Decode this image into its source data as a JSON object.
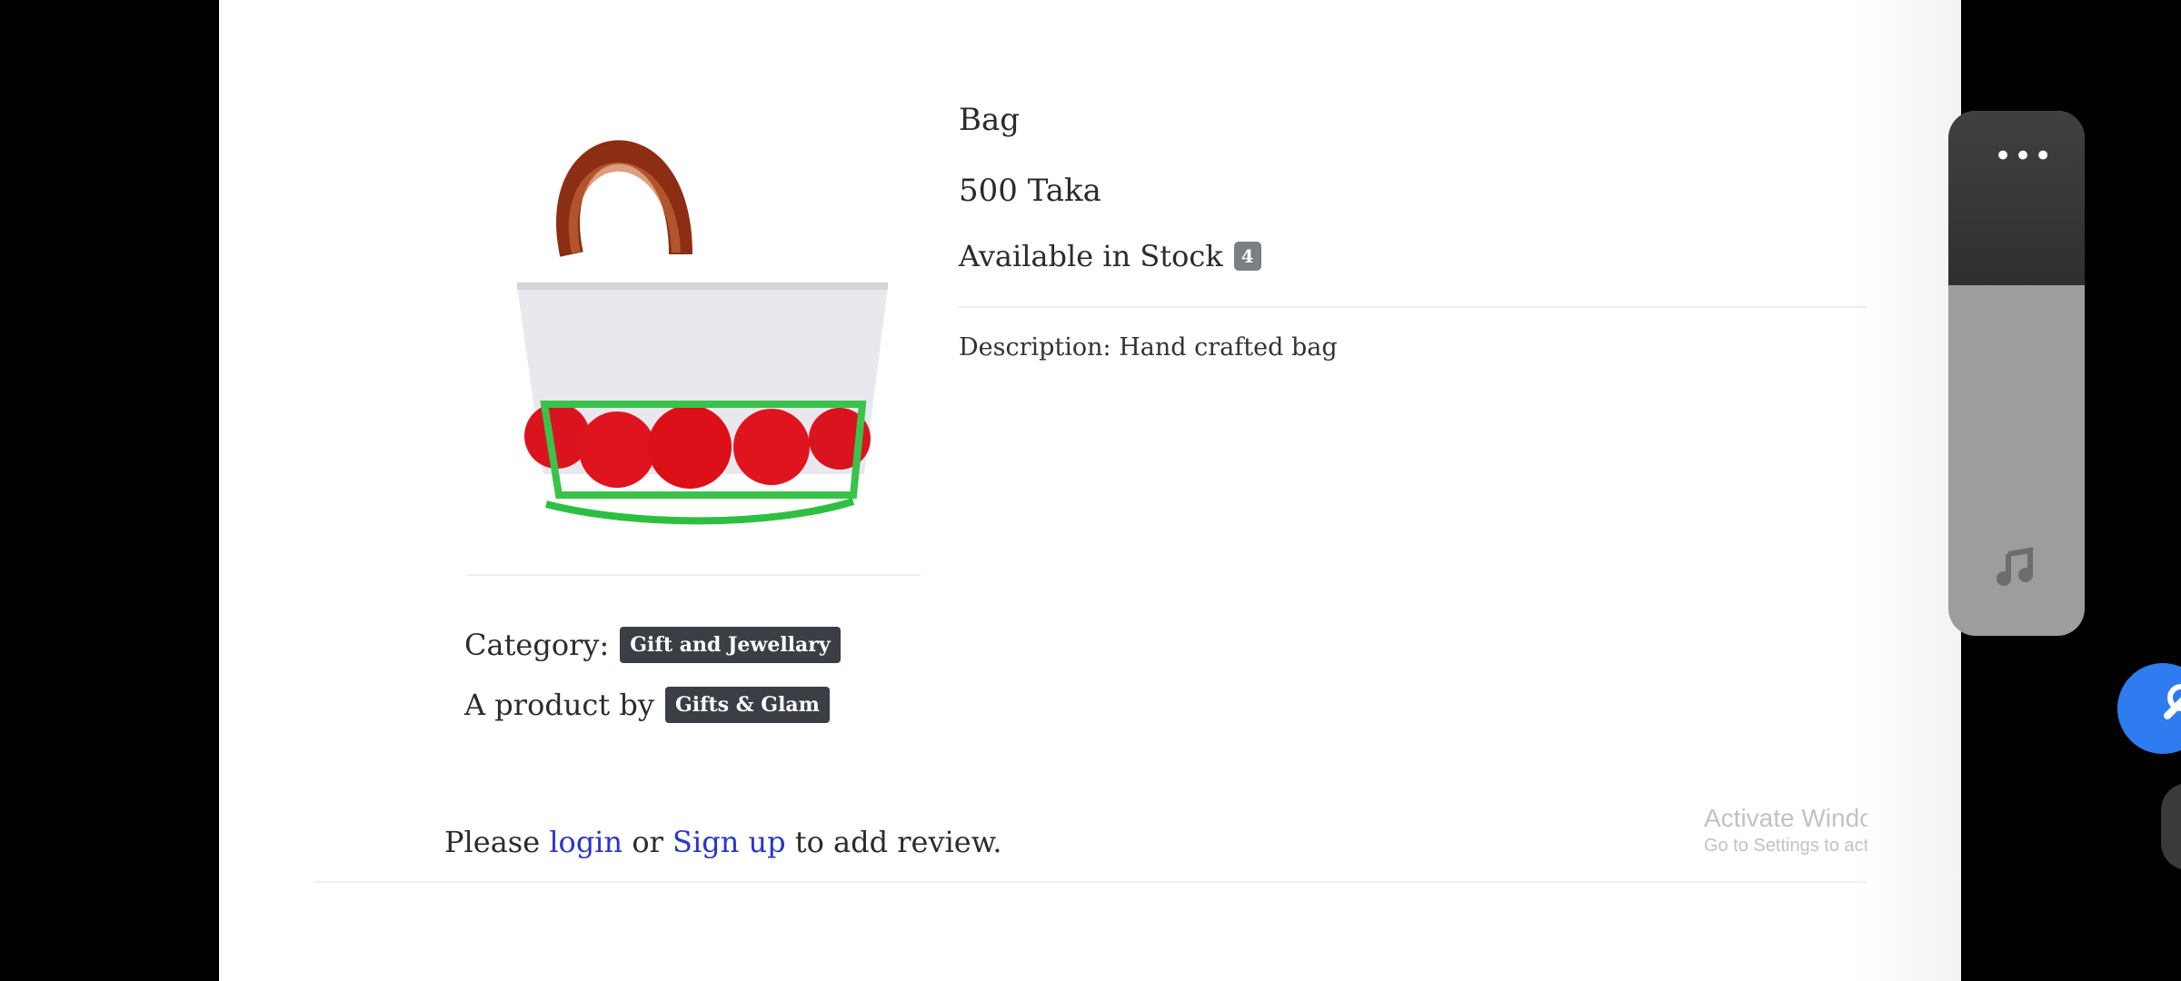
{
  "product": {
    "title": "Bag",
    "price": "500 Taka",
    "stock_label": "Available in Stock",
    "stock_count": "4",
    "description": "Description: Hand crafted bag",
    "category_label": "Category:",
    "category_value": "Gift and Jewellary",
    "seller_label": "A product by",
    "seller_value": "Gifts & Glam"
  },
  "review": {
    "prefix": "Please",
    "login": "login",
    "or": "or",
    "signup": "Sign up",
    "suffix": "to add review."
  },
  "watermark": {
    "title": "Activate Windows",
    "subtitle": "Go to Settings to activate Windows."
  },
  "colors": {
    "link": "#2a35c9",
    "badge_dark": "#3b3f45",
    "badge_gray": "#7a7f86",
    "floating_blue": "#2f7bf0"
  },
  "icons": [
    "more-icon",
    "music-icon",
    "floating-action-icon"
  ]
}
